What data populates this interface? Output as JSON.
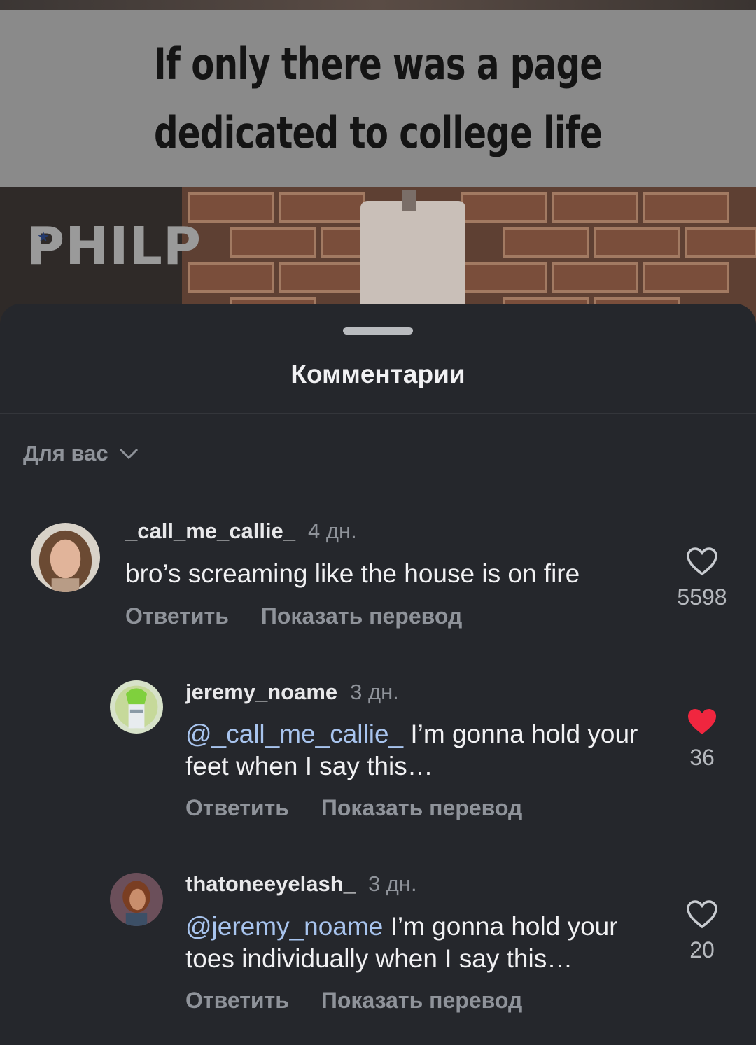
{
  "video": {
    "caption": "If only there was a page dedicated to college life",
    "watermark": "PHILP"
  },
  "comments_sheet": {
    "title": "Комментарии",
    "sort_label": "Для вас",
    "comments": [
      {
        "username": "_call_me_callie_",
        "time": "4 дн.",
        "mention": "",
        "text": "bro’s scream‍ing like the house is on fire",
        "reply_label": "Ответить",
        "translate_label": "Показать перевод",
        "likes": "5598",
        "liked": false
      },
      {
        "username": "jeremy_noame",
        "time": "3 дн.",
        "mention": "@_call_me_callie_",
        "text": " I’m gonna hold your feet when I say this…",
        "reply_label": "Ответить",
        "translate_label": "Показать перевод",
        "likes": "36",
        "liked": true
      },
      {
        "username": "thatoneeyelash_",
        "time": "3 дн.",
        "mention": "@jeremy_noame",
        "text": " I’m gonna hold your toes individually when I say this…",
        "reply_label": "Ответить",
        "translate_label": "Показать перевод",
        "likes": "20",
        "liked": false
      }
    ]
  },
  "colors": {
    "sheet_bg": "#25272c",
    "mention": "#a8c4ee",
    "liked_heart": "#f0263f",
    "muted_text": "#8f939a"
  },
  "icons": [
    "chevron-down-icon",
    "heart-outline-icon",
    "heart-filled-icon"
  ]
}
